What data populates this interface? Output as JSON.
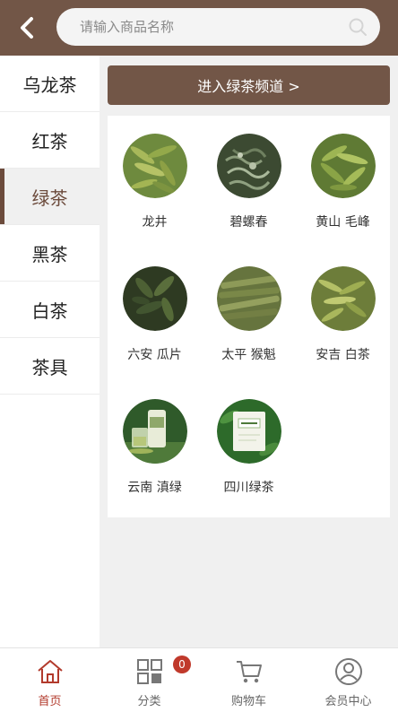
{
  "header": {
    "search_placeholder": "请输入商品名称"
  },
  "sidebar": {
    "items": [
      {
        "label": "乌龙茶",
        "active": false
      },
      {
        "label": "红茶",
        "active": false
      },
      {
        "label": "绿茶",
        "active": true
      },
      {
        "label": "黑茶",
        "active": false
      },
      {
        "label": "白茶",
        "active": false
      },
      {
        "label": "茶具",
        "active": false
      }
    ]
  },
  "main": {
    "channel_button": "进入绿茶频道 >",
    "teas": [
      {
        "name": "龙井",
        "icon": "longjing-leaf-photo"
      },
      {
        "name": "碧螺春",
        "icon": "biluochun-leaf-photo"
      },
      {
        "name": "黄山 毛峰",
        "icon": "huangshan-maofeng-leaf-photo"
      },
      {
        "name": "六安 瓜片",
        "icon": "luan-guapian-leaf-photo"
      },
      {
        "name": "太平 猴魁",
        "icon": "taiping-houkui-leaf-photo"
      },
      {
        "name": "安吉 白茶",
        "icon": "anji-baicha-leaf-photo"
      },
      {
        "name": "云南 滇绿",
        "icon": "yunnan-dianlv-package-photo"
      },
      {
        "name": "四川绿茶",
        "icon": "sichuan-lvcha-package-photo"
      }
    ]
  },
  "tabbar": {
    "items": [
      {
        "label": "首页",
        "icon": "home-icon",
        "active": true
      },
      {
        "label": "分类",
        "icon": "category-grid-icon",
        "active": false
      },
      {
        "label": "购物车",
        "icon": "cart-icon",
        "active": false
      },
      {
        "label": "会员中心",
        "icon": "user-icon",
        "active": false
      }
    ],
    "cart_count": "0"
  },
  "colors": {
    "brand": "#725647",
    "active_tab": "#b23a2c",
    "badge": "#c0392b"
  }
}
